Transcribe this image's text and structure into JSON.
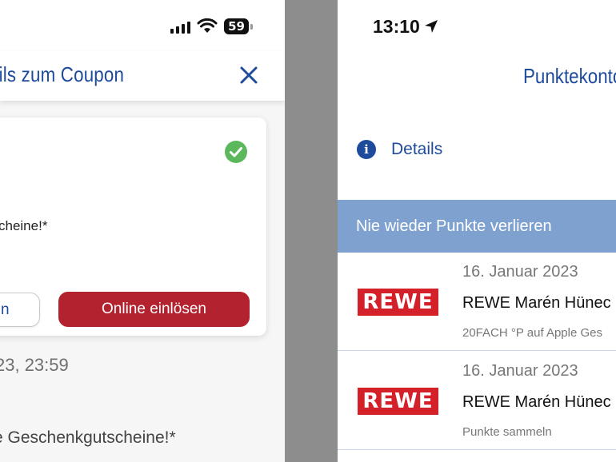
{
  "left_screen": {
    "status": {
      "battery": "59"
    },
    "header": {
      "title": "ails zum Coupon"
    },
    "coupon": {
      "text": "cheine!*",
      "secondary_button": "n",
      "primary_button": "Online einlösen"
    },
    "valid_until": "23, 23:59",
    "description": "e Geschenkgutscheine!*"
  },
  "right_screen": {
    "status": {
      "time": "13:10"
    },
    "header": {
      "title": "Punktekonto"
    },
    "details_link": "Details",
    "banner": "Nie wieder Punkte verlieren",
    "entries": [
      {
        "date": "16. Januar 2023",
        "partner_logo": "REWE",
        "name": "REWE Marén Hünec",
        "subtitle": "20FACH °P auf Apple Ges"
      },
      {
        "date": "16. Januar 2023",
        "partner_logo": "REWE",
        "name": "REWE Marén Hünec",
        "subtitle": "Punkte sammeln"
      }
    ]
  },
  "colors": {
    "brand_blue": "#1e4b9c",
    "primary_red": "#b3232f",
    "rewe_red": "#d32029",
    "banner_blue": "#7fa1d0",
    "success_green": "#5cb85c"
  },
  "icons": [
    "signal-icon",
    "wifi-icon",
    "battery-icon",
    "close-icon",
    "check-circle-icon",
    "location-arrow-icon",
    "info-icon"
  ]
}
